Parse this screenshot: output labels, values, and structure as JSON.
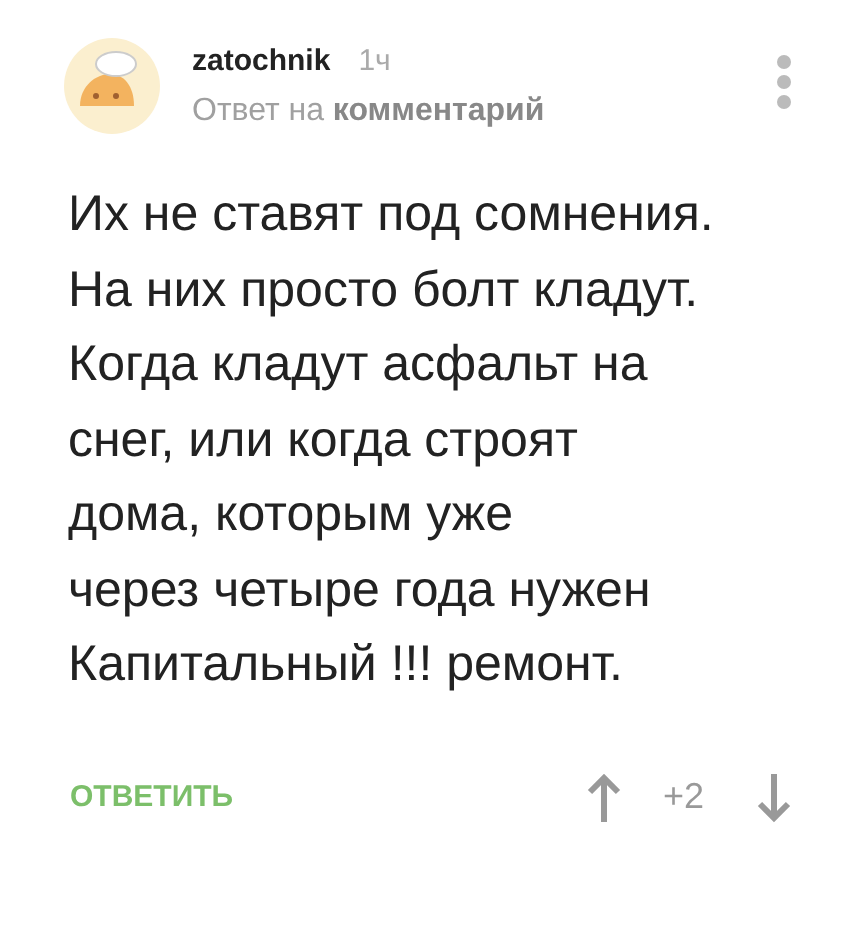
{
  "comment": {
    "author": "zatochnik",
    "time": "1ч",
    "reply_to": "Ответ на **комментарий**",
    "body_lines": [
      "Их не ставят под сомнения.",
      "На них просто болт кладут.",
      "Когда кладут асфальт на",
      "снег, или когда строят",
      "дома, которым уже",
      "через четыре года нужен",
      "Капитальный !!! ремонт."
    ],
    "reply_button": "ОТВЕТИТЬ",
    "rating": "+2"
  }
}
